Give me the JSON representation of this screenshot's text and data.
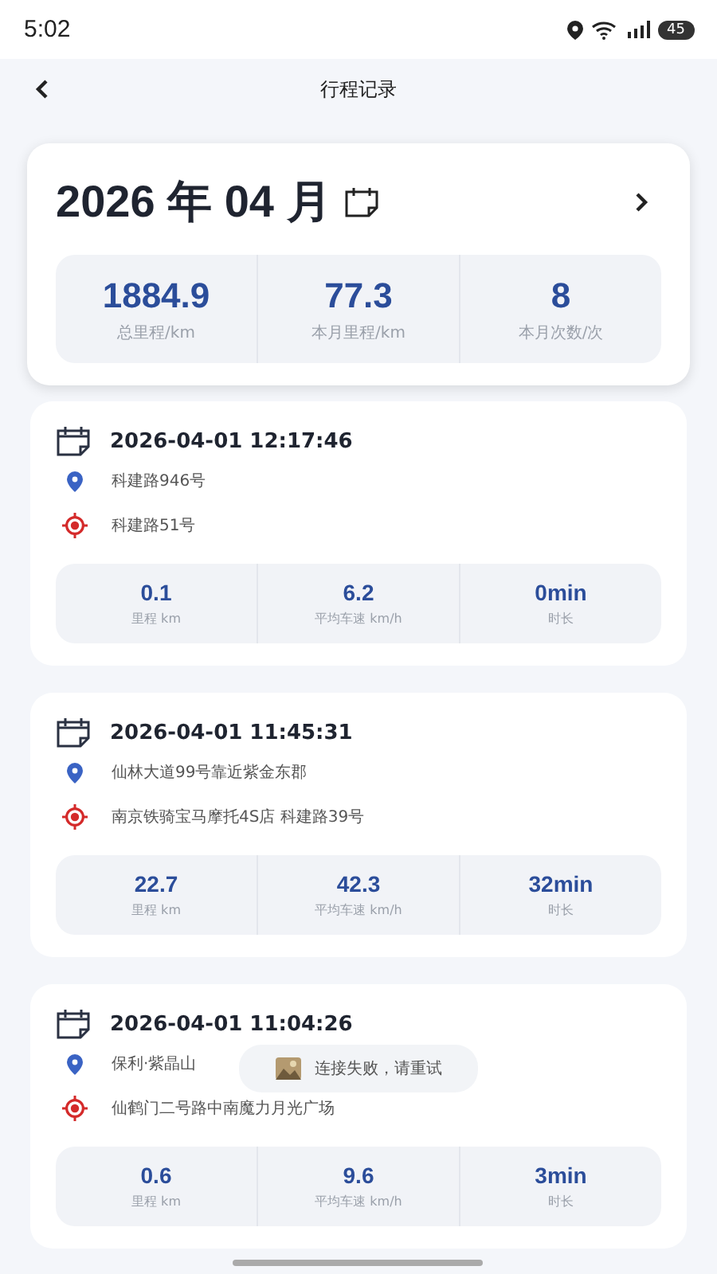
{
  "status_bar": {
    "time": "5:02",
    "battery": "45"
  },
  "nav": {
    "title": "行程记录"
  },
  "summary": {
    "title": "2026 年 04 月",
    "stats": [
      {
        "value": "1884.9",
        "label": "总里程/km"
      },
      {
        "value": "77.3",
        "label": "本月里程/km"
      },
      {
        "value": "8",
        "label": "本月次数/次"
      }
    ]
  },
  "trips": [
    {
      "datetime": "2026-04-01 12:17:46",
      "start": "科建路946号",
      "end": "科建路51号",
      "stats": [
        {
          "value": "0.1",
          "label": "里程 km"
        },
        {
          "value": "6.2",
          "label": "平均车速 km/h"
        },
        {
          "value": "0min",
          "label": "时长"
        }
      ]
    },
    {
      "datetime": "2026-04-01 11:45:31",
      "start": "仙林大道99号靠近紫金东郡",
      "end": "南京铁骑宝马摩托4S店 科建路39号",
      "stats": [
        {
          "value": "22.7",
          "label": "里程 km"
        },
        {
          "value": "42.3",
          "label": "平均车速 km/h"
        },
        {
          "value": "32min",
          "label": "时长"
        }
      ]
    },
    {
      "datetime": "2026-04-01 11:04:26",
      "start": "保利·紫晶山",
      "end": "仙鹤门二号路中南魔力月光广场",
      "stats": [
        {
          "value": "0.6",
          "label": "里程 km"
        },
        {
          "value": "9.6",
          "label": "平均车速 km/h"
        },
        {
          "value": "3min",
          "label": "时长"
        }
      ]
    }
  ],
  "toast": {
    "message": "连接失败，请重试"
  }
}
